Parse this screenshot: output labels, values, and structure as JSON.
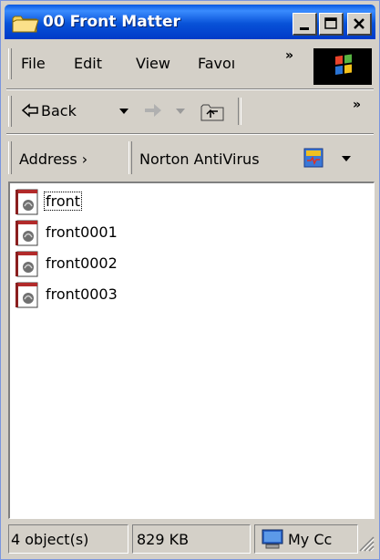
{
  "window": {
    "title": "00 Front Matter"
  },
  "menu": {
    "items": [
      {
        "label": "File"
      },
      {
        "label": "Edit"
      },
      {
        "label": "View"
      },
      {
        "label": "Favoı"
      }
    ],
    "overflow": "»"
  },
  "toolbar": {
    "back_label": "Back",
    "overflow": "»"
  },
  "addressbar": {
    "address_label": "Address ›",
    "norton_label": "Norton AntiVirus"
  },
  "files": [
    {
      "name": "front",
      "icon": "pdf-document-icon"
    },
    {
      "name": "front0001",
      "icon": "pdf-document-icon"
    },
    {
      "name": "front0002",
      "icon": "pdf-document-icon"
    },
    {
      "name": "front0003",
      "icon": "pdf-document-icon"
    }
  ],
  "statusbar": {
    "objects": "4 object(s)",
    "size": "829 KB",
    "location": "My Cc"
  },
  "colors": {
    "titlebar": "#0852d8",
    "face": "#d4d0c8",
    "content_bg": "#ffffff"
  }
}
